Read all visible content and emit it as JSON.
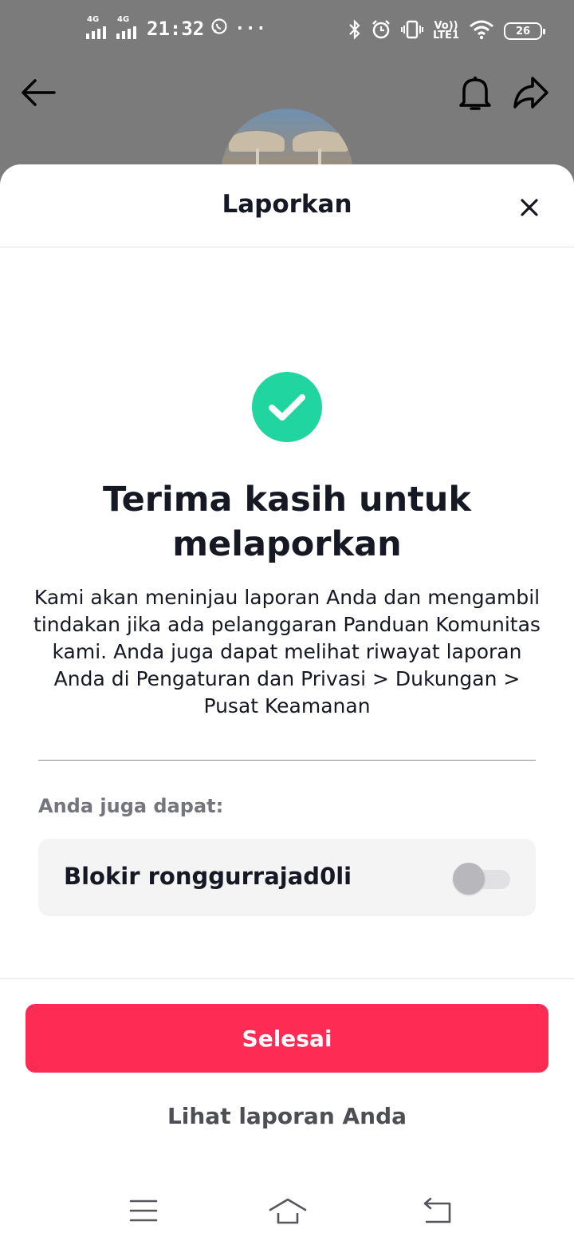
{
  "status_bar": {
    "network_1": "4G",
    "network_2": "4G",
    "time": "21:32",
    "more": "···",
    "lte_top": "Vo))",
    "lte_bottom": "LTE1",
    "battery": "26"
  },
  "top_nav": {
    "back_icon": "arrow-left-icon",
    "bell_icon": "bell-icon",
    "share_icon": "share-arrow-icon"
  },
  "sheet": {
    "title": "Laporkan",
    "close_icon": "close-icon",
    "success_icon": "checkmark-circle-icon",
    "heading": "Terima kasih untuk melaporkan",
    "body": "Kami akan meninjau laporan Anda dan mengambil tindakan jika ada pelanggaran Panduan Komunitas kami. Anda juga dapat melihat riwayat laporan Anda di Pengaturan dan Privasi > Dukungan > Pusat Keamanan",
    "also_label": "Anda juga dapat:",
    "block_label": "Blokir ronggurrajad0li",
    "block_toggle_on": false,
    "primary_button": "Selesai",
    "secondary_link": "Lihat laporan Anda"
  },
  "colors": {
    "accent": "#fe2c55",
    "success": "#20d5a0",
    "text": "#161823",
    "muted": "#75767c"
  },
  "nav_bar": {
    "menu_icon": "menu-icon",
    "home_icon": "home-icon",
    "back_icon": "return-icon"
  }
}
